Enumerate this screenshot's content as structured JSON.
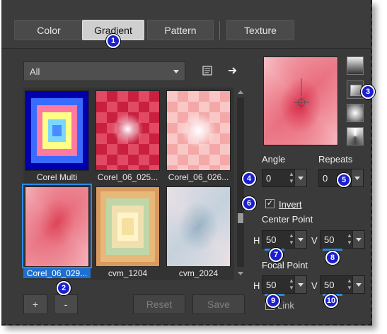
{
  "tabs": [
    {
      "label": "Color"
    },
    {
      "label": "Gradient"
    },
    {
      "label": "Pattern"
    },
    {
      "label": "Texture"
    }
  ],
  "category": {
    "selected": "All"
  },
  "gradients": [
    {
      "label": "Corel Multi"
    },
    {
      "label": "Corel_06_025..."
    },
    {
      "label": "Corel_06_026..."
    },
    {
      "label": "Corel_06_029..."
    },
    {
      "label": "cvm_1204"
    },
    {
      "label": "cvm_2024"
    }
  ],
  "buttons": {
    "add": "+",
    "remove": "-",
    "reset": "Reset",
    "save": "Save"
  },
  "angle": {
    "label": "Angle",
    "value": "0"
  },
  "repeats": {
    "label": "Repeats",
    "value": "0"
  },
  "invert": {
    "label": "Invert",
    "checked": true
  },
  "center_point": {
    "label": "Center Point",
    "h_label": "H",
    "h_value": "50",
    "v_label": "V",
    "v_value": "50"
  },
  "focal_point": {
    "label": "Focal Point",
    "h_label": "H",
    "h_value": "50",
    "v_label": "V",
    "v_value": "50"
  },
  "link": {
    "label": "Link"
  },
  "badges": [
    "1",
    "2",
    "3",
    "4",
    "5",
    "6",
    "7",
    "8",
    "9",
    "10"
  ],
  "colors": {
    "accent": "#2d8ae5",
    "badge": "#1b1fcf"
  }
}
